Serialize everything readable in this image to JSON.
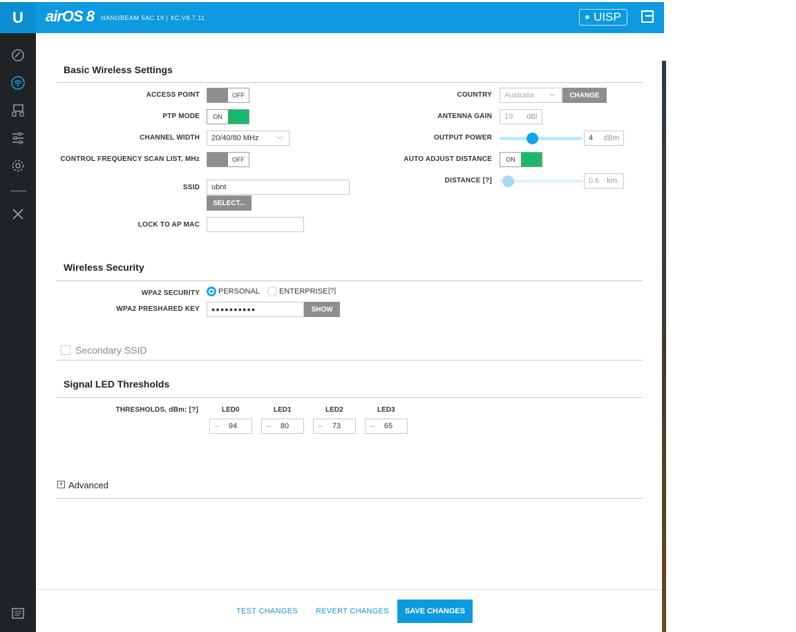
{
  "header": {
    "logo": "U",
    "brand": "airOS 8",
    "device": "NANOBEAM 5AC 19 | XC.V8.7.11",
    "uisp_label": "UISP",
    "logout_icon": "logout-icon"
  },
  "sidebar": {
    "items": [
      {
        "name": "dashboard",
        "icon": "gauge-icon"
      },
      {
        "name": "wireless",
        "icon": "wifi-icon",
        "active": true
      },
      {
        "name": "network",
        "icon": "network-icon"
      },
      {
        "name": "services",
        "icon": "sliders-icon"
      },
      {
        "name": "system",
        "icon": "gear-icon"
      },
      {
        "name": "tools",
        "icon": "tools-icon"
      },
      {
        "name": "log",
        "icon": "log-icon"
      }
    ]
  },
  "basic": {
    "title": "Basic Wireless Settings",
    "access_point": {
      "label": "ACCESS POINT",
      "state": "OFF"
    },
    "ptp_mode": {
      "label": "PTP MODE",
      "state": "ON"
    },
    "channel_width": {
      "label": "CHANNEL WIDTH",
      "value": "20/40/80 MHz"
    },
    "scan_list": {
      "label": "CONTROL FREQUENCY SCAN LIST, MHz",
      "state": "OFF"
    },
    "ssid": {
      "label": "SSID",
      "value": "ubnt",
      "select_label": "SELECT..."
    },
    "lock_ap_mac": {
      "label": "LOCK TO AP MAC",
      "value": ""
    },
    "country": {
      "label": "COUNTRY",
      "value": "Australia",
      "change_label": "CHANGE"
    },
    "antenna_gain": {
      "label": "ANTENNA GAIN",
      "value": "19",
      "unit": "dBi"
    },
    "output_power": {
      "label": "OUTPUT POWER",
      "value": "4",
      "unit": "dBm"
    },
    "auto_adjust": {
      "label": "AUTO ADJUST DISTANCE",
      "state": "ON"
    },
    "distance": {
      "label": "DISTANCE [?]",
      "value": "0.6",
      "unit": "km."
    }
  },
  "security": {
    "title": "Wireless Security",
    "wpa2_label": "WPA2 SECURITY",
    "personal_label": "PERSONAL",
    "enterprise_label": "ENTERPRISE",
    "help": "[?]",
    "key_label": "WPA2 PRESHARED KEY",
    "key_value": "●●●●●●●●●●",
    "show_label": "SHOW"
  },
  "secondary_ssid": {
    "label": "Secondary SSID"
  },
  "led": {
    "title": "Signal LED Thresholds",
    "thresholds_label": "THRESHOLDS, dBm: [?]",
    "sign": "–",
    "items": [
      {
        "name": "LED0",
        "value": "94"
      },
      {
        "name": "LED1",
        "value": "80"
      },
      {
        "name": "LED2",
        "value": "73"
      },
      {
        "name": "LED3",
        "value": "65"
      }
    ]
  },
  "advanced": {
    "label": "Advanced",
    "expand_symbol": "+"
  },
  "footer": {
    "test_label": "TEST CHANGES",
    "revert_label": "REVERT CHANGES",
    "save_label": "SAVE CHANGES"
  }
}
